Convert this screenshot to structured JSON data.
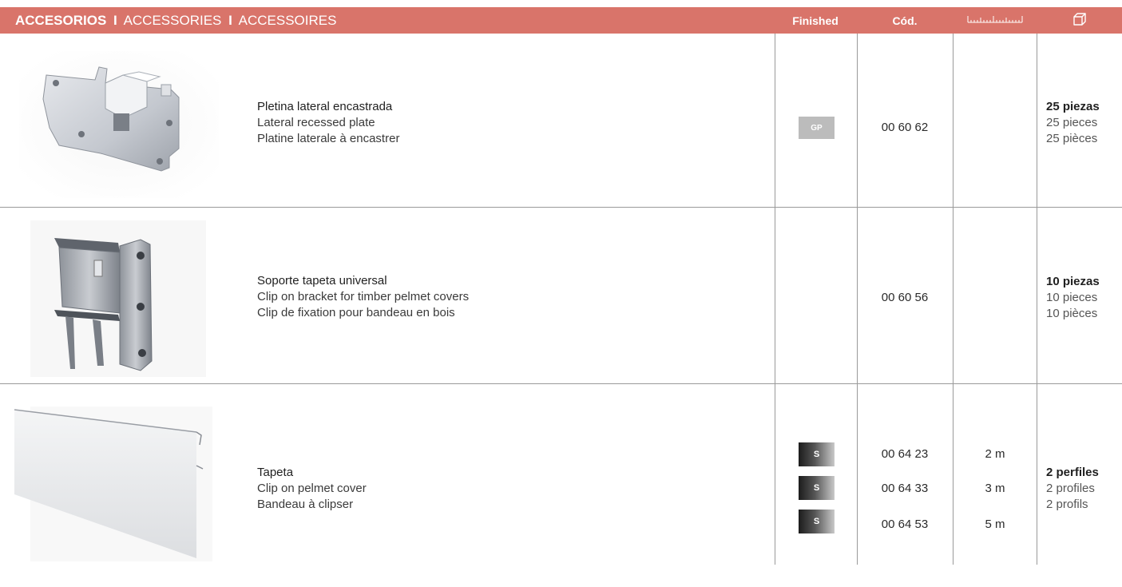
{
  "header": {
    "title_es": "ACCESORIOS",
    "separator": "I",
    "title_en": "ACCESSORIES",
    "title_fr": "ACCESSOIRES",
    "col_finished": "Finished",
    "col_code": "Cód.",
    "col_length_icon": "ruler-icon",
    "col_pack_icon": "box-icon"
  },
  "rows": [
    {
      "name_es": "Pletina lateral encastrada",
      "name_en": "Lateral recessed plate",
      "name_fr": "Platine laterale à encastrer",
      "finish": "GP",
      "code": "00 60 62",
      "pack_es": "25 piezas",
      "pack_en": "25 pieces",
      "pack_fr": "25 pièces"
    },
    {
      "name_es": "Soporte tapeta universal",
      "name_en": "Clip on bracket for timber pelmet covers",
      "name_fr": "Clip de fixation pour bandeau en bois",
      "code": "00 60 56",
      "pack_es": "10 piezas",
      "pack_en": "10 pieces",
      "pack_fr": "10 pièces"
    },
    {
      "name_es": "Tapeta",
      "name_en": "Clip on pelmet cover",
      "name_fr": "Bandeau à clipser",
      "variants": [
        {
          "finish": "S",
          "code": "00 64 23",
          "length": "2 m"
        },
        {
          "finish": "S",
          "code": "00 64 33",
          "length": "3 m"
        },
        {
          "finish": "S",
          "code": "00 64 53",
          "length": "5 m"
        }
      ],
      "pack_es": "2 perfiles",
      "pack_en": "2 profiles",
      "pack_fr": "2 profils"
    }
  ]
}
